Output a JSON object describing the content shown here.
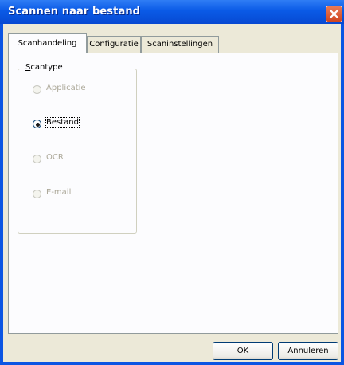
{
  "window": {
    "title": "Scannen naar bestand"
  },
  "tabs": [
    {
      "label": "Scanhandeling",
      "active": true
    },
    {
      "label": "Configuratie",
      "active": false
    },
    {
      "label": "Scaninstellingen",
      "active": false
    }
  ],
  "scantype": {
    "label": "Scantype",
    "options": [
      {
        "label": "Applicatie",
        "enabled": false,
        "selected": false
      },
      {
        "label": "Bestand",
        "enabled": true,
        "selected": true
      },
      {
        "label": "OCR",
        "enabled": false,
        "selected": false
      },
      {
        "label": "E-mail",
        "enabled": false,
        "selected": false
      }
    ]
  },
  "buttons": {
    "ok": "OK",
    "cancel": "Annuleren"
  },
  "colors": {
    "titlebar": "#0a5ae6",
    "dialog": "#ece9d8",
    "close": "#d0451f"
  }
}
